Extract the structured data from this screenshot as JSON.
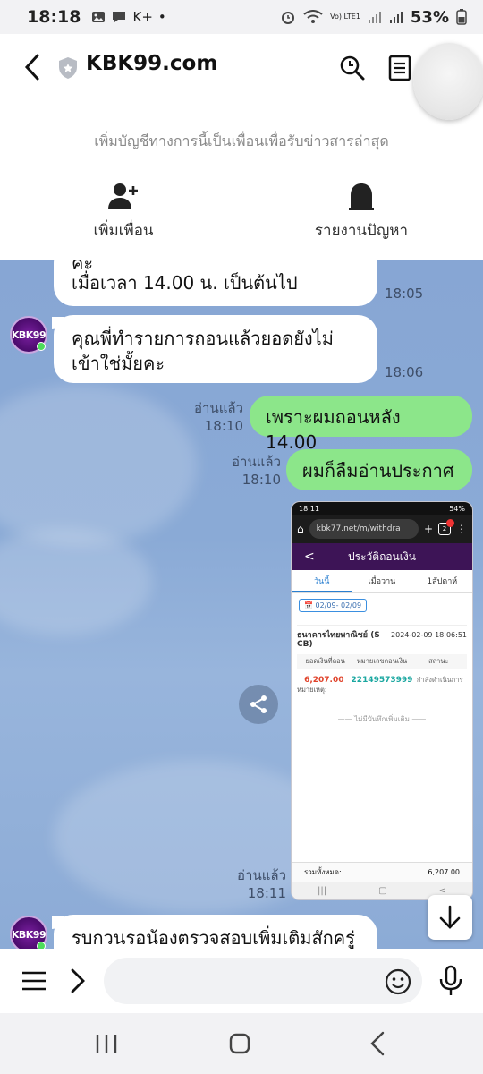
{
  "status_bar": {
    "time": "18:18",
    "left_icons": [
      "image-icon",
      "chat-bubble-icon",
      "k-plus-icon",
      "dot-icon"
    ],
    "carrier_label": "K+",
    "network_label": "Vo) LTE1",
    "battery": "53%"
  },
  "header": {
    "title": "KBK99.com",
    "note": "เพิ่มบัญชีทางการนี้เป็นเพื่อนเพื่อรับข่าวสารล่าสุด",
    "add_friend_label": "เพิ่มเพื่อน",
    "report_label": "รายงานปัญหา"
  },
  "messages": [
    {
      "type": "in",
      "text_line1": "คะ",
      "text_line2": "เมื่อเวลา 14.00 น. เป็นต้นไป",
      "time": "18:05"
    },
    {
      "type": "in",
      "text_line1": "คุณพี่ทำรายการถอนแล้วยอดยังไม่",
      "text_line2": "เข้าใช่มั้ยคะ",
      "time": "18:06"
    },
    {
      "type": "out",
      "text": "เพราะผมถอนหลัง 14.00",
      "read": "อ่านแล้ว",
      "time": "18:10"
    },
    {
      "type": "out",
      "text": "ผมก็ลืมอ่านประกาศ",
      "read": "อ่านแล้ว",
      "time": "18:10"
    },
    {
      "type": "out-image",
      "read": "อ่านแล้ว",
      "time": "18:11"
    },
    {
      "type": "in",
      "text": "รบกวนรอน้องตรวจสอบเพิ่มเติมสักครู่"
    }
  ],
  "profile": {
    "logo_text": "KBK99"
  },
  "screenshot": {
    "status_time": "18:11",
    "status_right": "54%",
    "url": "kbk77.net/m/withdra",
    "tab_count": "2",
    "title": "ประวัติถอนเงิน",
    "tabs": [
      "วันนี้",
      "เมื่อวาน",
      "1สัปดาห์"
    ],
    "date_range": "02/09- 02/09",
    "bank": "ธนาคารไทยพาณิชย์ (S CB)",
    "datetime": "2024-02-09 18:06:51",
    "col_amount": "ยอดเงินที่ถอน",
    "col_number": "หมายเลขถอนเงิน",
    "col_status": "สถานะ",
    "amount": "6,207.00",
    "number": "22149573999",
    "status": "กำลังดำเนินการ",
    "note_label": "หมายเหตุ:",
    "no_more": "ไม่มีบันทึกเพิ่มเติม",
    "total_label": "รวมทั้งหมด:",
    "total_value": "6,207.00"
  },
  "input": {
    "placeholder": ""
  },
  "colors": {
    "chat_bg": "#8aa9d6",
    "out_bubble": "#8ce68a",
    "in_bubble": "#ffffff",
    "header_bg": "#ffffff"
  }
}
